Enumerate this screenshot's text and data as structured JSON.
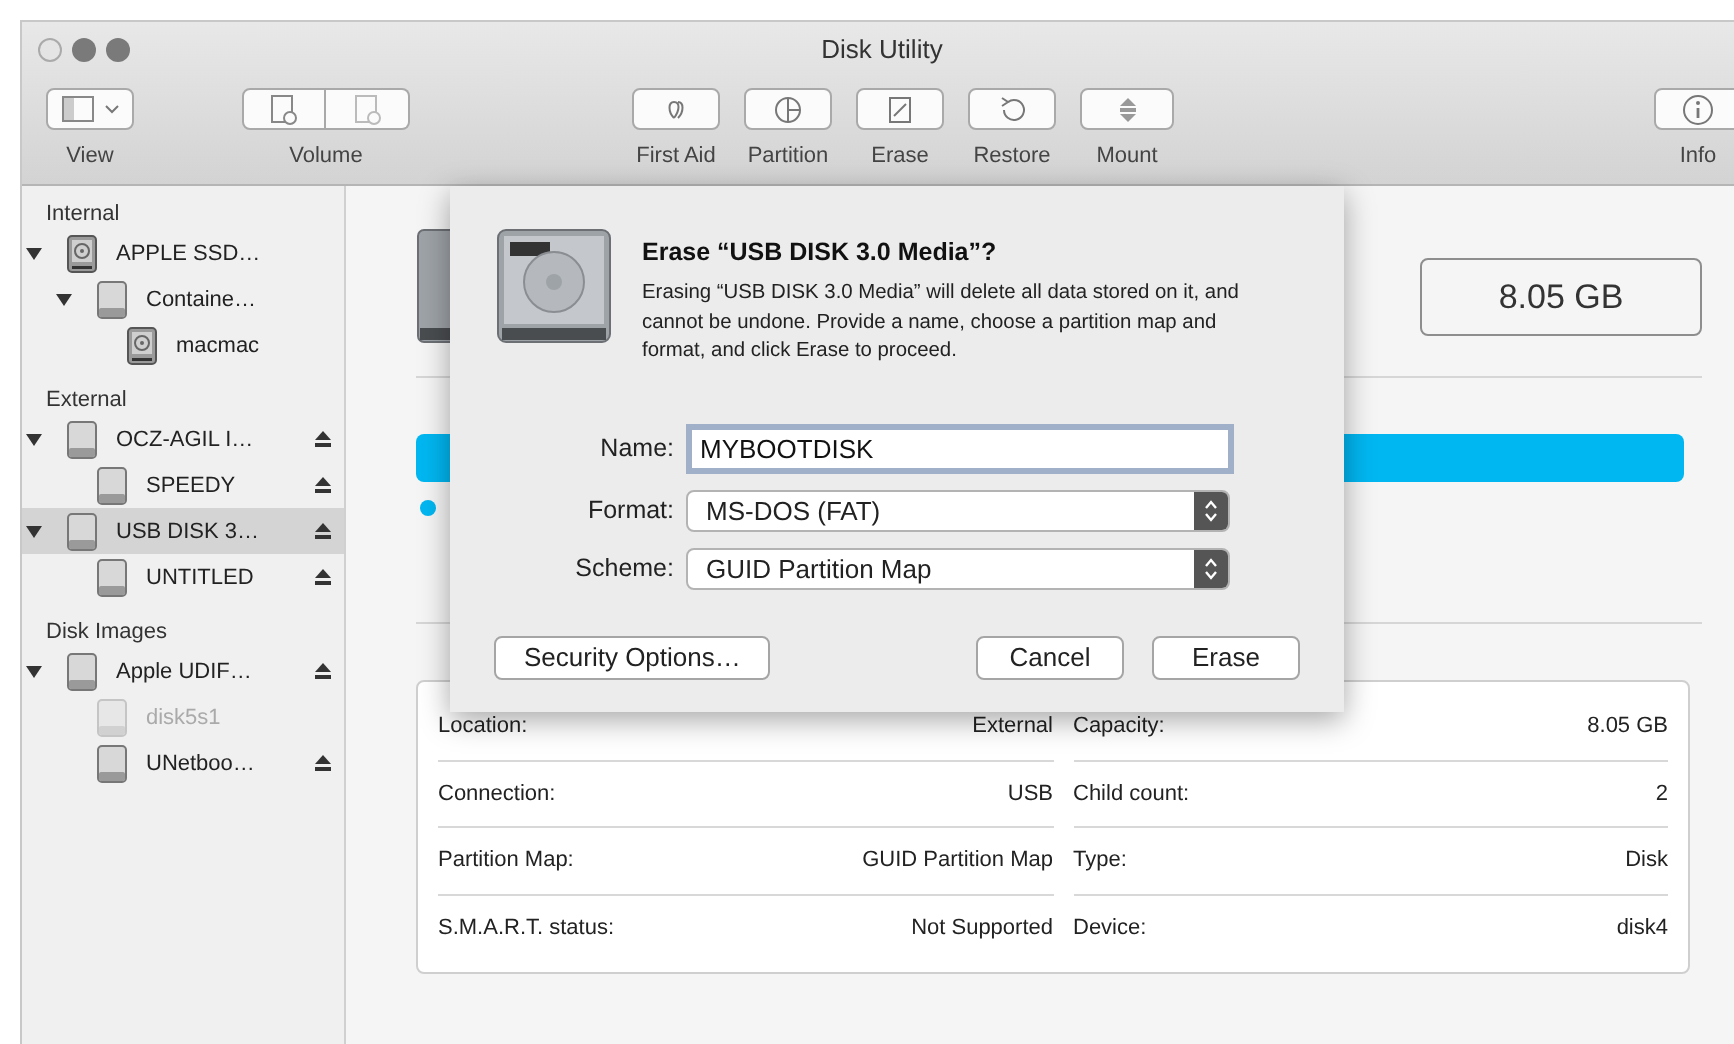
{
  "window": {
    "title": "Disk Utility"
  },
  "toolbar": [
    {
      "kind": "view",
      "label": "View"
    },
    {
      "kind": "volume",
      "label": "Volume"
    },
    {
      "kind": "first-aid",
      "label": "First Aid"
    },
    {
      "kind": "partition",
      "label": "Partition"
    },
    {
      "kind": "erase",
      "label": "Erase"
    },
    {
      "kind": "restore",
      "label": "Restore"
    },
    {
      "kind": "mount",
      "label": "Mount"
    },
    {
      "kind": "info",
      "label": "Info"
    }
  ],
  "sidebar": {
    "sections": [
      {
        "title": "Internal",
        "items": [
          {
            "name": "APPLE SSD…",
            "kind": "internal",
            "expanded": true,
            "selected": false,
            "disabled": false,
            "eject": false,
            "children": [
              {
                "name": "Containe…",
                "kind": "external",
                "expanded": true,
                "selected": false,
                "disabled": false,
                "eject": false,
                "children": [
                  {
                    "name": "macmac",
                    "kind": "internal",
                    "selected": false,
                    "disabled": false,
                    "eject": false
                  }
                ]
              }
            ]
          }
        ]
      },
      {
        "title": "External",
        "items": [
          {
            "name": "OCZ-AGIL I…",
            "kind": "external",
            "expanded": true,
            "selected": false,
            "disabled": false,
            "eject": true,
            "children": [
              {
                "name": "SPEEDY",
                "kind": "external",
                "selected": false,
                "disabled": false,
                "eject": true
              }
            ]
          },
          {
            "name": "USB DISK 3…",
            "kind": "external",
            "expanded": true,
            "selected": true,
            "disabled": false,
            "eject": true,
            "children": [
              {
                "name": "UNTITLED",
                "kind": "external",
                "selected": false,
                "disabled": false,
                "eject": true
              }
            ]
          }
        ]
      },
      {
        "title": "Disk Images",
        "items": [
          {
            "name": "Apple UDIF…",
            "kind": "external",
            "expanded": true,
            "selected": false,
            "disabled": false,
            "eject": true,
            "children": [
              {
                "name": "disk5s1",
                "kind": "external",
                "selected": false,
                "disabled": true,
                "eject": false
              },
              {
                "name": "UNetboo…",
                "kind": "external",
                "selected": false,
                "disabled": false,
                "eject": true
              }
            ]
          }
        ]
      }
    ]
  },
  "disk": {
    "capacity": "8.05 GB"
  },
  "details": {
    "left": [
      {
        "label": "Location:",
        "value": "External"
      },
      {
        "label": "Connection:",
        "value": "USB"
      },
      {
        "label": "Partition Map:",
        "value": "GUID Partition Map"
      },
      {
        "label": "S.M.A.R.T. status:",
        "value": "Not Supported"
      }
    ],
    "right": [
      {
        "label": "Capacity:",
        "value": "8.05 GB"
      },
      {
        "label": "Child count:",
        "value": "2"
      },
      {
        "label": "Type:",
        "value": "Disk"
      },
      {
        "label": "Device:",
        "value": "disk4"
      }
    ]
  },
  "sheet": {
    "title": "Erase “USB DISK 3.0 Media”?",
    "message": "Erasing “USB DISK 3.0 Media” will delete all data stored on it, and cannot be undone. Provide a name, choose a partition map and format, and click Erase to proceed.",
    "fields": [
      {
        "kind": "text",
        "label": "Name:",
        "value": "MYBOOTDISK"
      },
      {
        "kind": "popup",
        "label": "Format:",
        "value": "MS-DOS (FAT)"
      },
      {
        "kind": "popup",
        "label": "Scheme:",
        "value": "GUID Partition Map"
      }
    ],
    "buttons": [
      {
        "kind": "options",
        "label": "Security Options…"
      },
      {
        "kind": "cancel",
        "label": "Cancel"
      },
      {
        "kind": "confirm",
        "label": "Erase"
      }
    ]
  }
}
